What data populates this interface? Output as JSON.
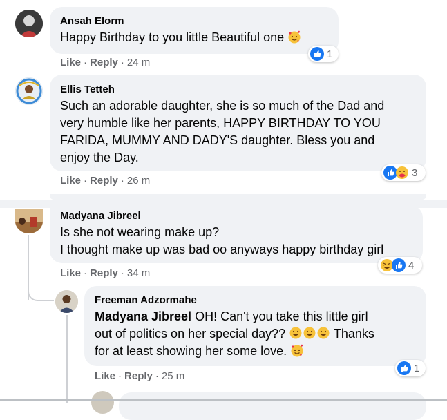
{
  "comments": [
    {
      "author": "Ansah Elorm",
      "text": "Happy Birthday to you little Beautiful one",
      "actions": {
        "like": "Like",
        "reply": "Reply",
        "time": "24 m"
      },
      "reactions": {
        "icons": [
          "like-icon"
        ],
        "count": "1"
      }
    },
    {
      "author": "Ellis Tetteh",
      "lines": [
        "Such an adorable daughter, she is so much of the Dad and",
        "very humble like her parents, HAPPY BIRTHDAY TO YOU",
        "FARIDA, MUMMY AND DADY'S daughter. Bless you and",
        "enjoy the Day."
      ],
      "actions": {
        "like": "Like",
        "reply": "Reply",
        "time": "26 m"
      },
      "reactions": {
        "icons": [
          "like-icon",
          "care-icon"
        ],
        "count": "3"
      }
    },
    {
      "author": "Madyana Jibreel",
      "lines": [
        "Is she not wearing make up?",
        "I thought make up was bad oo anyways happy birthday girl"
      ],
      "actions": {
        "like": "Like",
        "reply": "Reply",
        "time": "34 m"
      },
      "reactions": {
        "icons": [
          "haha-icon",
          "like-icon"
        ],
        "count": "4"
      }
    },
    {
      "author": "Freeman Adzormahe",
      "mention": "Madyana Jibreel",
      "line1_rest": " OH! Can't you take this little girl",
      "line2": "out of politics on her special day??",
      "line2_tail": " Thanks",
      "line3": "for at least showing her some love.",
      "actions": {
        "like": "Like",
        "reply": "Reply",
        "time": "25 m"
      },
      "reactions": {
        "icons": [
          "like-icon"
        ],
        "count": "1"
      }
    }
  ],
  "colors": {
    "bubble": "#f0f2f5",
    "like_blue": "#1877f2",
    "muted_text": "#65676b"
  }
}
